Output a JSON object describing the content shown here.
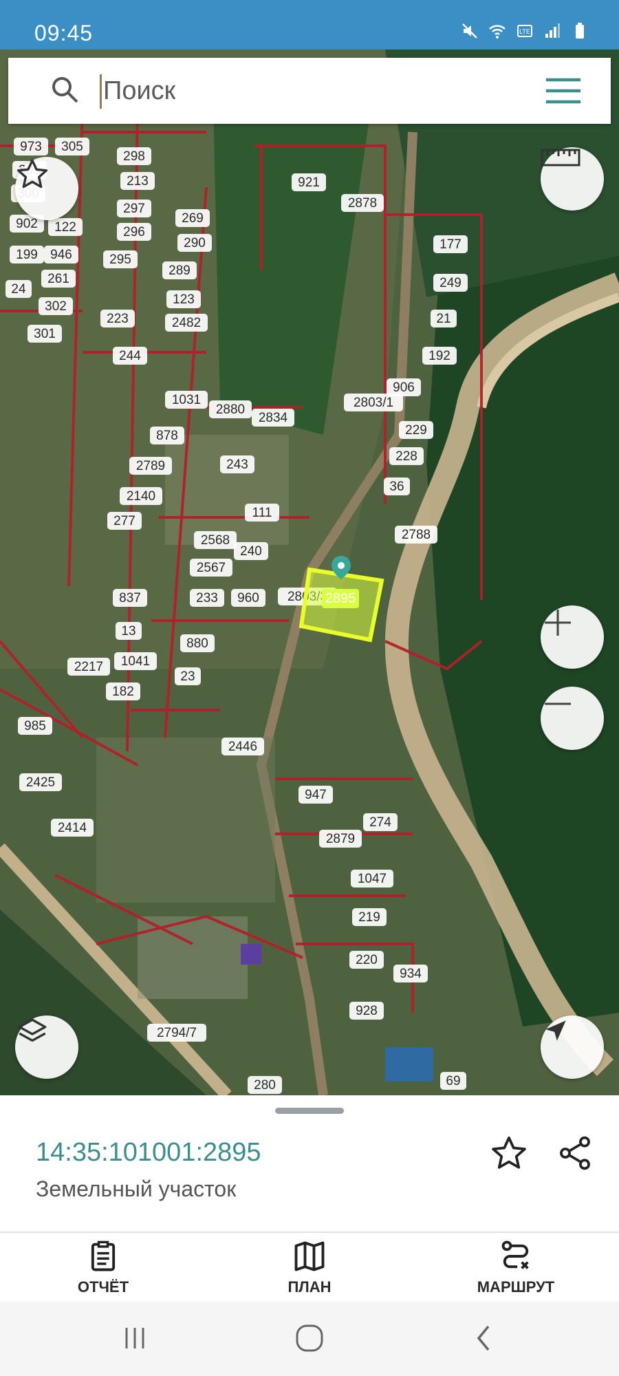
{
  "status_bar": {
    "time": "09:45"
  },
  "search": {
    "placeholder": "Поиск"
  },
  "map": {
    "parcel_labels": [
      "973",
      "305",
      "298",
      "305",
      "213",
      "300",
      "297",
      "269",
      "902",
      "122",
      "296",
      "290",
      "199",
      "946",
      "295",
      "289",
      "261",
      "24",
      "302",
      "123",
      "2482",
      "223",
      "301",
      "244",
      "921",
      "2878",
      "177",
      "249",
      "21",
      "192",
      "2803/1",
      "906",
      "1031",
      "2880",
      "2834",
      "878",
      "229",
      "228",
      "243",
      "2789",
      "36",
      "2140",
      "111",
      "277",
      "2788",
      "2568",
      "240",
      "2567",
      "960",
      "2803/3",
      "837",
      "233",
      "2895",
      "13",
      "880",
      "1041",
      "2217",
      "23",
      "182",
      "985",
      "2446",
      "2425",
      "947",
      "274",
      "2414",
      "2879",
      "1047",
      "219",
      "220",
      "934",
      "928",
      "2794/7",
      "280",
      "69"
    ],
    "selected_parcel_label": "2895"
  },
  "selected_parcel": {
    "cadastral_number": "14:35:101001:2895",
    "type": "Земельный участок"
  },
  "bottom_nav": [
    {
      "label": "ОТЧЁТ",
      "icon": "clipboard-icon"
    },
    {
      "label": "ПЛАН",
      "icon": "map-plan-icon"
    },
    {
      "label": "МАРШРУТ",
      "icon": "route-icon"
    }
  ],
  "colors": {
    "status_bar": "#3b8fc4",
    "parcel_border": "#b3202a",
    "selected_parcel": "#e6ff3b",
    "accent_text": "#3b8f8b"
  }
}
